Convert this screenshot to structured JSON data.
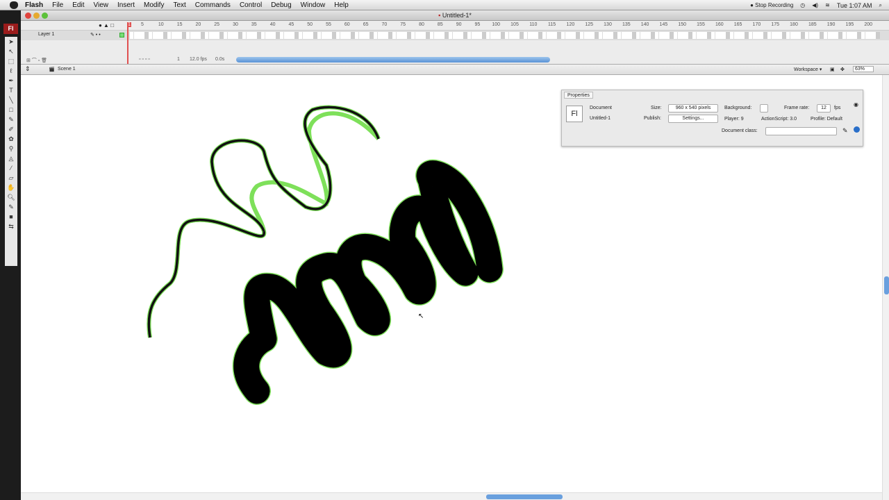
{
  "menubar": {
    "app": "Flash",
    "items": [
      "File",
      "Edit",
      "View",
      "Insert",
      "Modify",
      "Text",
      "Commands",
      "Control",
      "Debug",
      "Window",
      "Help"
    ],
    "stop_recording": "Stop Recording",
    "clock": "Tue 1:07 AM"
  },
  "window": {
    "title": "Untitled-1*"
  },
  "tools": {
    "logo": "Fl"
  },
  "timeline": {
    "layer": "Layer 1",
    "frame_numbers": [
      "5",
      "10",
      "15",
      "20",
      "25",
      "30",
      "35",
      "40",
      "45",
      "50",
      "55",
      "60",
      "65",
      "70",
      "75",
      "80",
      "85",
      "90",
      "95",
      "100",
      "105",
      "110",
      "115",
      "120",
      "125",
      "130",
      "135",
      "140",
      "145",
      "150",
      "155",
      "160",
      "165",
      "170",
      "175",
      "180",
      "185",
      "190",
      "195",
      "200"
    ],
    "current_frame": "1",
    "fps": "12.0 fps",
    "time": "0.0s"
  },
  "scene": {
    "name": "Scene 1",
    "workspace": "Workspace ▾",
    "zoom": "63%"
  },
  "properties": {
    "tab": "Properties",
    "type": "Document",
    "doc_name": "Untitled-1",
    "size_label": "Size:",
    "size_value": "960 x 540 pixels",
    "publish_label": "Publish:",
    "settings_button": "Settings...",
    "background_label": "Background:",
    "frame_rate_label": "Frame rate:",
    "frame_rate": "12",
    "fps_unit": "fps",
    "player": "Player: 9",
    "actionscript": "ActionScript: 3.0",
    "profile": "Profile: Default",
    "document_class_label": "Document class:",
    "document_class": ""
  },
  "colors": {
    "accent": "#5a93d6",
    "stroke_highlight": "#7ee05a"
  }
}
